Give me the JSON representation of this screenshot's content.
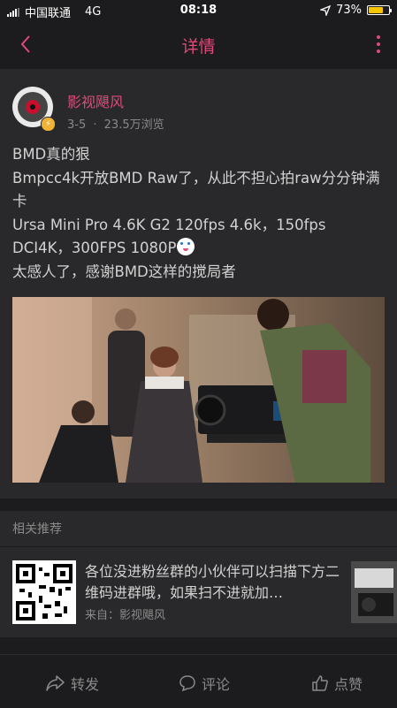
{
  "status_bar": {
    "carrier": "中国联通",
    "network": "4G",
    "time": "08:18",
    "battery_percent": "73%",
    "battery_level": 0.73
  },
  "navbar": {
    "back_icon": "chevron-left-icon",
    "title": "详情",
    "more_icon": "more-vertical-icon"
  },
  "post": {
    "author": "影视飓风",
    "date": "3-5",
    "separator": "·",
    "views": "23.5万浏览",
    "lines": [
      "BMD真的狠",
      "Bmpcc4k开放BMD Raw了，从此不担心拍raw分分钟满卡",
      "Ursa Mini Pro 4.6K G2 120fps 4.6k，150fps DCI4K，300FPS 1080P",
      "太感人了，感谢BMD这样的搅局者"
    ]
  },
  "related": {
    "header": "相关推荐",
    "items": [
      {
        "title": "各位没进粉丝群的小伙伴可以扫描下方二维码进群哦，如果扫不进就加…",
        "source_prefix": "来自：",
        "source": "影视飓风"
      }
    ]
  },
  "actions": {
    "share": "转发",
    "comment": "评论",
    "like": "点赞"
  },
  "colors": {
    "accent": "#e04a78",
    "background": "#1c1c1e",
    "card": "#29292b"
  }
}
